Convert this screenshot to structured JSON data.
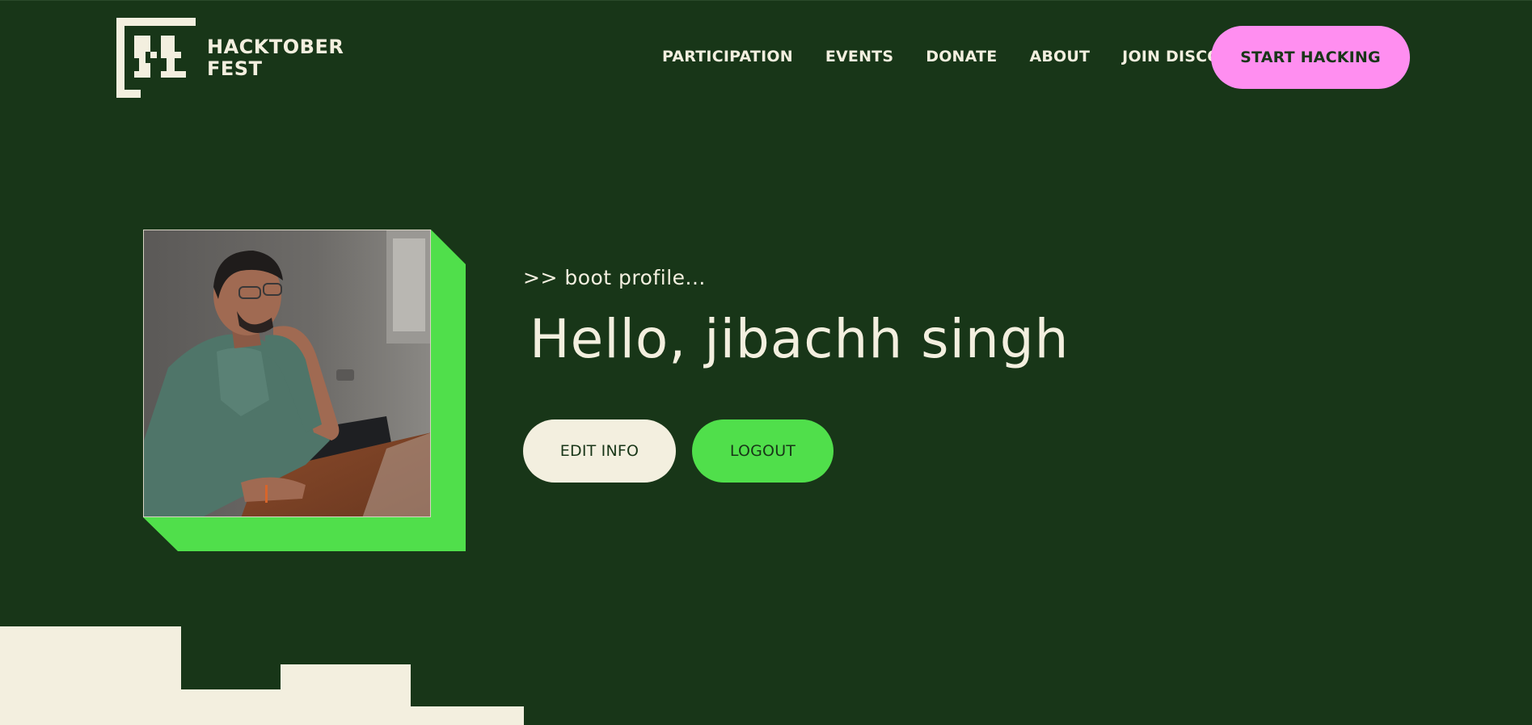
{
  "header": {
    "logo": {
      "line1": "HACKTOBER",
      "line2": "FEST"
    },
    "nav": [
      {
        "label": "PARTICIPATION"
      },
      {
        "label": "EVENTS"
      },
      {
        "label": "DONATE"
      },
      {
        "label": "ABOUT"
      },
      {
        "label": "JOIN DISCORD"
      }
    ],
    "cta_label": "START HACKING"
  },
  "profile": {
    "boot_text": ">> boot profile...",
    "greeting": "Hello, jibachh singh",
    "edit_label": "EDIT INFO",
    "logout_label": "LOGOUT"
  },
  "colors": {
    "background": "#183618",
    "cream": "#f3efdf",
    "green_accent": "#50df4b",
    "pink_accent": "#ff8ef0"
  }
}
